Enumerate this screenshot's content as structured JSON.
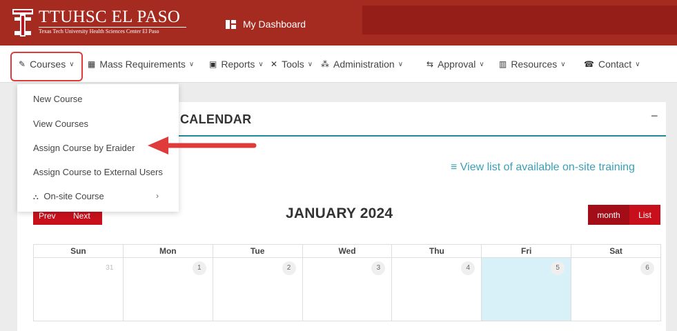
{
  "header": {
    "brand_title": "TTUHSC EL PASO",
    "brand_subtitle": "Texas Tech University Health Sciences Center El Paso",
    "dashboard_label": "My Dashboard"
  },
  "nav": {
    "items": [
      {
        "label": "Courses",
        "icon": "book-icon"
      },
      {
        "label": "Mass Requirements",
        "icon": "calendar-icon"
      },
      {
        "label": "Reports",
        "icon": "monitor-icon"
      },
      {
        "label": "Tools",
        "icon": "tools-icon"
      },
      {
        "label": "Administration",
        "icon": "users-icon"
      },
      {
        "label": "Approval",
        "icon": "handshake-icon"
      },
      {
        "label": "Resources",
        "icon": "library-icon"
      },
      {
        "label": "Contact",
        "icon": "contact-icon"
      }
    ]
  },
  "dropdown": {
    "items": [
      {
        "label": "New Course"
      },
      {
        "label": "View Courses"
      },
      {
        "label": "Assign Course by Eraider"
      },
      {
        "label": "Assign Course to External Users"
      },
      {
        "label": "On-site Course",
        "icon": "sitemap-icon",
        "has_submenu": true
      }
    ]
  },
  "calendar": {
    "title": "CALENDAR",
    "collapse_label": "−",
    "view_list_label": "≡ View list of available on-site training",
    "prev_label": "Prev",
    "next_label": "Next",
    "month_label": "month",
    "list_label": "List",
    "month_title": "JANUARY 2024",
    "weekdays": [
      "Sun",
      "Mon",
      "Tue",
      "Wed",
      "Thu",
      "Fri",
      "Sat"
    ],
    "days": [
      "31",
      "1",
      "2",
      "3",
      "4",
      "5",
      "6"
    ],
    "today_index": 5
  },
  "colors": {
    "header_red": "#a52a1f",
    "button_red": "#c8101c",
    "accent_teal": "#1e8c93",
    "link_teal": "#3aa0b5",
    "today_bg": "#d8f1f8",
    "highlight_red": "#e03b3b"
  }
}
